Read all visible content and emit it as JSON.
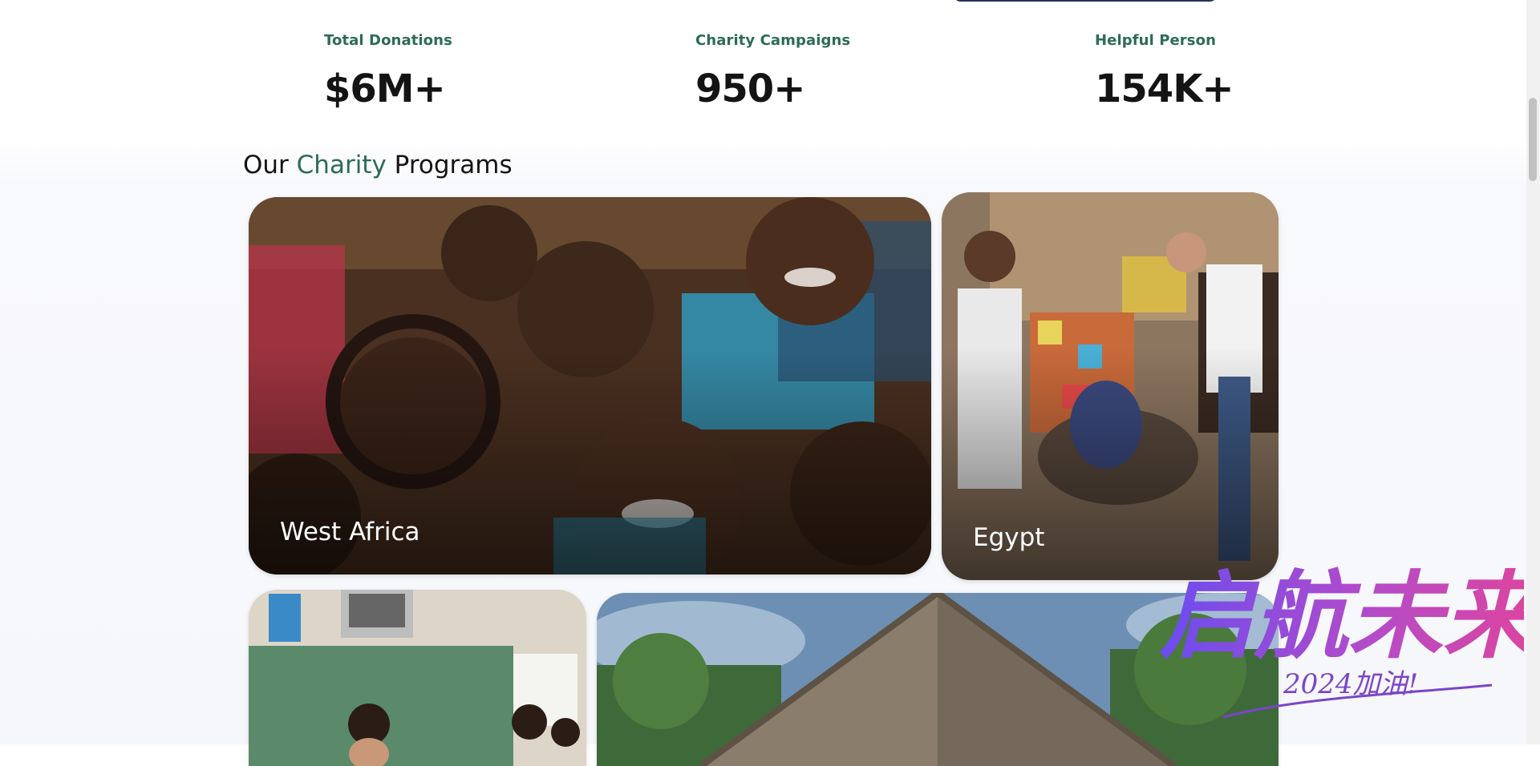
{
  "stats": [
    {
      "label": "Total Donations",
      "value": "$6M+"
    },
    {
      "label": "Charity Campaigns",
      "value": "950+"
    },
    {
      "label": "Helpful Person",
      "value": "154K+"
    }
  ],
  "programs": {
    "title_prefix": "Our",
    "title_accent": "Charity",
    "title_suffix": "Programs",
    "cards": [
      {
        "label": "West Africa"
      },
      {
        "label": "Egypt"
      },
      {
        "label": ""
      },
      {
        "label": ""
      }
    ]
  },
  "watermark": {
    "main": "启航未来",
    "sub": "2024加油!"
  },
  "colors": {
    "accent": "#2c6b56",
    "heading": "#141414",
    "watermark_start": "#6a4cf0",
    "watermark_end": "#e0449a"
  }
}
